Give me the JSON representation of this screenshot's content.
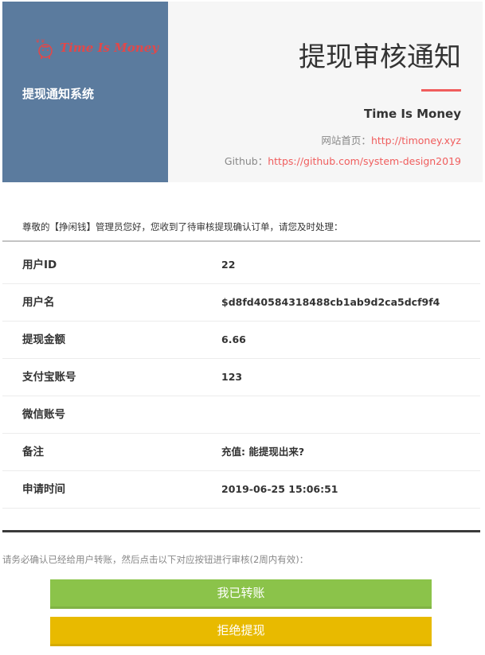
{
  "header": {
    "logo_text": "Time Is Money",
    "system_name": "提现通知系统",
    "notice_title": "提现审核通知",
    "brand": "Time Is Money",
    "website_label": "网站首页：",
    "website_url": "http://timoney.xyz",
    "github_label": "Github：",
    "github_url": "https://github.com/system-design2019",
    "accent_color": "#f05d5d",
    "panel_color": "#5b7b9e"
  },
  "greeting": "尊敬的【挣闲钱】管理员您好，您收到了待审核提现确认订单，请您及时处理：",
  "details": [
    {
      "label": "用户ID",
      "value": "22"
    },
    {
      "label": "用户名",
      "value": "$d8fd40584318488cb1ab9d2ca5dcf9f4"
    },
    {
      "label": "提现金额",
      "value": "6.66"
    },
    {
      "label": "支付宝账号",
      "value": "123"
    },
    {
      "label": "微信账号",
      "value": ""
    },
    {
      "label": "备注",
      "value": "充值: 能提现出来?"
    },
    {
      "label": "申请时间",
      "value": "2019-06-25 15:06:51"
    }
  ],
  "instruction": "请务必确认已经给用户转账，然后点击以下对应按钮进行审核(2周内有效)：",
  "buttons": {
    "confirm_label": "我已转账",
    "reject_label": "拒绝提现",
    "confirm_color": "#8bc34a",
    "reject_color": "#e8ba00"
  }
}
